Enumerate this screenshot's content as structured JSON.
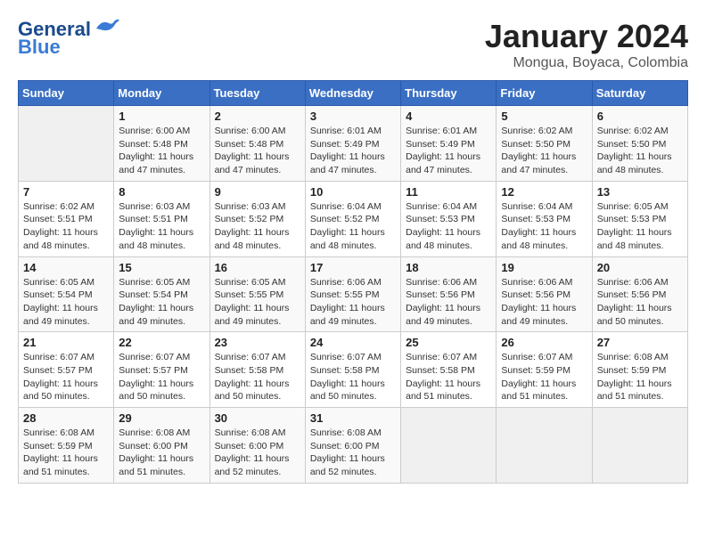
{
  "header": {
    "logo_general": "General",
    "logo_blue": "Blue",
    "title": "January 2024",
    "subtitle": "Mongua, Boyaca, Colombia"
  },
  "weekdays": [
    "Sunday",
    "Monday",
    "Tuesday",
    "Wednesday",
    "Thursday",
    "Friday",
    "Saturday"
  ],
  "weeks": [
    [
      {
        "num": "",
        "info": ""
      },
      {
        "num": "1",
        "info": "Sunrise: 6:00 AM\nSunset: 5:48 PM\nDaylight: 11 hours\nand 47 minutes."
      },
      {
        "num": "2",
        "info": "Sunrise: 6:00 AM\nSunset: 5:48 PM\nDaylight: 11 hours\nand 47 minutes."
      },
      {
        "num": "3",
        "info": "Sunrise: 6:01 AM\nSunset: 5:49 PM\nDaylight: 11 hours\nand 47 minutes."
      },
      {
        "num": "4",
        "info": "Sunrise: 6:01 AM\nSunset: 5:49 PM\nDaylight: 11 hours\nand 47 minutes."
      },
      {
        "num": "5",
        "info": "Sunrise: 6:02 AM\nSunset: 5:50 PM\nDaylight: 11 hours\nand 47 minutes."
      },
      {
        "num": "6",
        "info": "Sunrise: 6:02 AM\nSunset: 5:50 PM\nDaylight: 11 hours\nand 48 minutes."
      }
    ],
    [
      {
        "num": "7",
        "info": "Sunrise: 6:02 AM\nSunset: 5:51 PM\nDaylight: 11 hours\nand 48 minutes."
      },
      {
        "num": "8",
        "info": "Sunrise: 6:03 AM\nSunset: 5:51 PM\nDaylight: 11 hours\nand 48 minutes."
      },
      {
        "num": "9",
        "info": "Sunrise: 6:03 AM\nSunset: 5:52 PM\nDaylight: 11 hours\nand 48 minutes."
      },
      {
        "num": "10",
        "info": "Sunrise: 6:04 AM\nSunset: 5:52 PM\nDaylight: 11 hours\nand 48 minutes."
      },
      {
        "num": "11",
        "info": "Sunrise: 6:04 AM\nSunset: 5:53 PM\nDaylight: 11 hours\nand 48 minutes."
      },
      {
        "num": "12",
        "info": "Sunrise: 6:04 AM\nSunset: 5:53 PM\nDaylight: 11 hours\nand 48 minutes."
      },
      {
        "num": "13",
        "info": "Sunrise: 6:05 AM\nSunset: 5:53 PM\nDaylight: 11 hours\nand 48 minutes."
      }
    ],
    [
      {
        "num": "14",
        "info": "Sunrise: 6:05 AM\nSunset: 5:54 PM\nDaylight: 11 hours\nand 49 minutes."
      },
      {
        "num": "15",
        "info": "Sunrise: 6:05 AM\nSunset: 5:54 PM\nDaylight: 11 hours\nand 49 minutes."
      },
      {
        "num": "16",
        "info": "Sunrise: 6:05 AM\nSunset: 5:55 PM\nDaylight: 11 hours\nand 49 minutes."
      },
      {
        "num": "17",
        "info": "Sunrise: 6:06 AM\nSunset: 5:55 PM\nDaylight: 11 hours\nand 49 minutes."
      },
      {
        "num": "18",
        "info": "Sunrise: 6:06 AM\nSunset: 5:56 PM\nDaylight: 11 hours\nand 49 minutes."
      },
      {
        "num": "19",
        "info": "Sunrise: 6:06 AM\nSunset: 5:56 PM\nDaylight: 11 hours\nand 49 minutes."
      },
      {
        "num": "20",
        "info": "Sunrise: 6:06 AM\nSunset: 5:56 PM\nDaylight: 11 hours\nand 50 minutes."
      }
    ],
    [
      {
        "num": "21",
        "info": "Sunrise: 6:07 AM\nSunset: 5:57 PM\nDaylight: 11 hours\nand 50 minutes."
      },
      {
        "num": "22",
        "info": "Sunrise: 6:07 AM\nSunset: 5:57 PM\nDaylight: 11 hours\nand 50 minutes."
      },
      {
        "num": "23",
        "info": "Sunrise: 6:07 AM\nSunset: 5:58 PM\nDaylight: 11 hours\nand 50 minutes."
      },
      {
        "num": "24",
        "info": "Sunrise: 6:07 AM\nSunset: 5:58 PM\nDaylight: 11 hours\nand 50 minutes."
      },
      {
        "num": "25",
        "info": "Sunrise: 6:07 AM\nSunset: 5:58 PM\nDaylight: 11 hours\nand 51 minutes."
      },
      {
        "num": "26",
        "info": "Sunrise: 6:07 AM\nSunset: 5:59 PM\nDaylight: 11 hours\nand 51 minutes."
      },
      {
        "num": "27",
        "info": "Sunrise: 6:08 AM\nSunset: 5:59 PM\nDaylight: 11 hours\nand 51 minutes."
      }
    ],
    [
      {
        "num": "28",
        "info": "Sunrise: 6:08 AM\nSunset: 5:59 PM\nDaylight: 11 hours\nand 51 minutes."
      },
      {
        "num": "29",
        "info": "Sunrise: 6:08 AM\nSunset: 6:00 PM\nDaylight: 11 hours\nand 51 minutes."
      },
      {
        "num": "30",
        "info": "Sunrise: 6:08 AM\nSunset: 6:00 PM\nDaylight: 11 hours\nand 52 minutes."
      },
      {
        "num": "31",
        "info": "Sunrise: 6:08 AM\nSunset: 6:00 PM\nDaylight: 11 hours\nand 52 minutes."
      },
      {
        "num": "",
        "info": ""
      },
      {
        "num": "",
        "info": ""
      },
      {
        "num": "",
        "info": ""
      }
    ]
  ]
}
